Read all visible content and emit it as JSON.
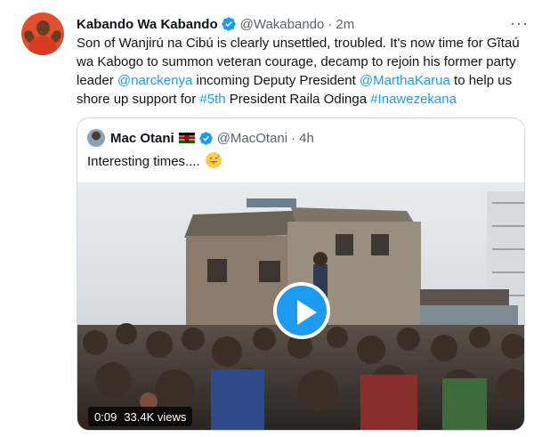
{
  "tweet": {
    "author_name": "Kabando Wa Kabando",
    "handle": "@Wakabando",
    "separator": "·",
    "time": "2m",
    "more": "···",
    "text_parts": {
      "p1": "Son of Wanjirú na Cibú is clearly unsettled, troubled. It's now time for Gĩtaú wa Kabogo to summon veteran courage, decamp to rejoin his former party leader ",
      "mention1": "@narckenya",
      "p2": " incoming Deputy President ",
      "mention2": "@MarthaKarua",
      "p3": " to help us shore up support for ",
      "hashtag1": "#5th",
      "p4": " President Raila Odinga ",
      "hashtag2": "#Inawezekana"
    }
  },
  "quote": {
    "author_name": "Mac Otani",
    "handle": "@MacOtani",
    "separator": "·",
    "time": "4h",
    "text": "Interesting times....",
    "emoji_name": "grinning-sweat-emoji",
    "video": {
      "duration": "0:09",
      "views": "33.4K views",
      "play_icon": "play-icon"
    }
  },
  "colors": {
    "accent": "#1d9bf0",
    "text": "#0f1419",
    "secondary": "#536471",
    "border": "#cfd9de"
  }
}
